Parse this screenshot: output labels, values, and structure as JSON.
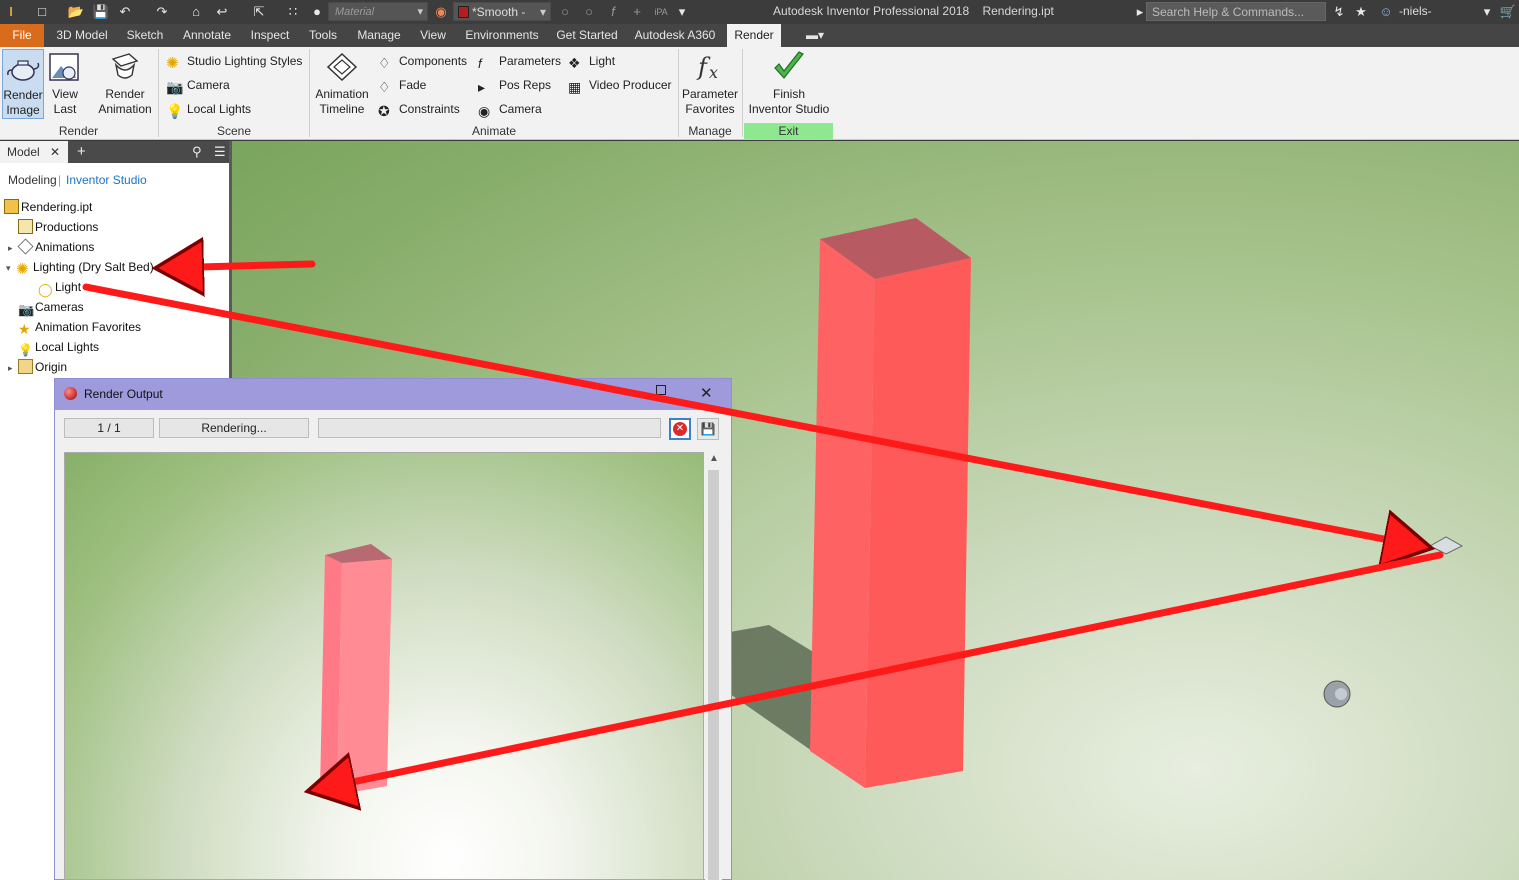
{
  "window": {
    "app_title": "Autodesk Inventor Professional 2018",
    "document_title": "Rendering.ipt",
    "search_placeholder": "Search Help & Commands...",
    "user_name": "-niels-"
  },
  "quick_access": {
    "material_value": "Material",
    "appearance_value": "*Smooth -"
  },
  "tabs": [
    {
      "label": "File"
    },
    {
      "label": "3D Model"
    },
    {
      "label": "Sketch"
    },
    {
      "label": "Annotate"
    },
    {
      "label": "Inspect"
    },
    {
      "label": "Tools"
    },
    {
      "label": "Manage"
    },
    {
      "label": "View"
    },
    {
      "label": "Environments"
    },
    {
      "label": "Get Started"
    },
    {
      "label": "Autodesk A360"
    },
    {
      "label": "Render"
    }
  ],
  "ribbon": {
    "render_panel": {
      "title": "Render",
      "render_image": "Render\nImage",
      "view_last": "View\nLast",
      "render_animation": "Render\nAnimation"
    },
    "scene_panel": {
      "title": "Scene",
      "studio_lighting_styles": "Studio Lighting Styles",
      "camera": "Camera",
      "local_lights": "Local Lights"
    },
    "animate_panel": {
      "title": "Animate",
      "animation_timeline": "Animation\nTimeline",
      "components": "Components",
      "fade": "Fade",
      "constraints": "Constraints",
      "parameters": "Parameters",
      "pos_reps": "Pos Reps",
      "camera": "Camera",
      "light": "Light",
      "video_producer": "Video Producer"
    },
    "manage_panel": {
      "title": "Manage",
      "parameter_favorites": "Parameter\nFavorites"
    },
    "exit_panel": {
      "title": "Exit",
      "finish_studio": "Finish\nInventor Studio"
    }
  },
  "browser": {
    "tab_label": "Model",
    "mode_modeling": "Modeling",
    "mode_studio": "Inventor Studio",
    "tree": [
      {
        "label": "Rendering.ipt"
      },
      {
        "label": "Productions"
      },
      {
        "label": "Animations"
      },
      {
        "label": "Lighting (Dry Salt Bed)"
      },
      {
        "label": "Light"
      },
      {
        "label": "Cameras"
      },
      {
        "label": "Animation Favorites"
      },
      {
        "label": "Local Lights"
      },
      {
        "label": "Origin"
      }
    ]
  },
  "render_output": {
    "title": "Render Output",
    "frame_counter": "1 / 1",
    "status": "Rendering...",
    "progress": 0
  },
  "colors": {
    "accent_orange": "#d96b1d",
    "exit_green": "#8fe88f",
    "annotation_red": "#ff1a1a",
    "block_red": "#ff6b6b"
  }
}
